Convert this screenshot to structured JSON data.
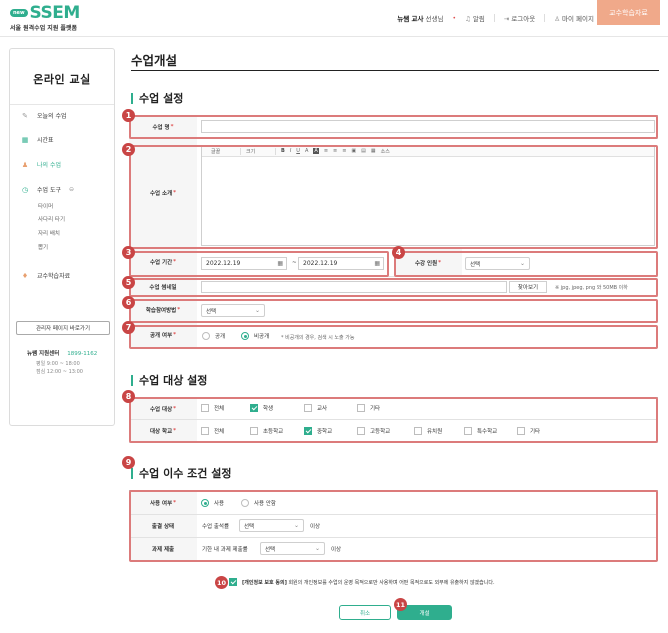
{
  "header": {
    "logo_new": "new",
    "logo_name": "SSEM",
    "logo_subtitle": "서울 원격수업 지원 플랫폼",
    "user_role": "뉴쌤 교사",
    "user_suffix": "선생님",
    "alarm": "알림",
    "logout": "로그아웃",
    "mypage": "마이 페이지",
    "prof_button": "교수학습자료"
  },
  "sidebar": {
    "title": "온라인 교실",
    "items": [
      {
        "label": "오늘의 수업",
        "icon": "pencil-icon"
      },
      {
        "label": "시간표",
        "icon": "calendar-icon"
      },
      {
        "label": "나의 수업",
        "icon": "person-icon"
      },
      {
        "label": "수업 도구",
        "icon": "stopwatch-icon"
      },
      {
        "label": "교수학습자료",
        "icon": "lightbulb-icon"
      }
    ],
    "tool_subitems": [
      "타이머",
      "사다리 타기",
      "자리 배치",
      "뽑기"
    ],
    "admin_button": "관리자 페이지 바로가기",
    "support_label": "뉴쌤 지원센터",
    "support_phone": "1899-1162",
    "hours_weekday": "평일 9:00 ~ 18:00",
    "hours_lunch": "점심 12:00 ~ 13:00"
  },
  "main": {
    "page_title": "수업개설",
    "section1_title": "수업 설정",
    "section2_title": "수업 대상 설정",
    "section3_title": "수업 이수 조건 설정",
    "fields": {
      "class_name_label": "수업 명",
      "class_intro_label": "수업 소개",
      "period_label": "수업 기간",
      "start_date": "2022.12.19",
      "date_sep": "~",
      "end_date": "2022.12.19",
      "capacity_label": "수강 인원",
      "capacity_value": "선택",
      "thumbnail_label": "수업 썸네일",
      "browse_button": "찾아보기",
      "thumbnail_hint": "※ jpg, jpeg, png 와 50MB 이하",
      "method_label": "학습참여방법",
      "method_value": "선택",
      "public_label": "공개 여부",
      "public_on": "공개",
      "public_off": "비공개",
      "public_hint": "* 비공개의 경우, 검색 시 노출 가능"
    },
    "editor_toolbar": [
      "글꼴",
      "크기",
      "B",
      "I",
      "U",
      "A",
      "A",
      "≡",
      "≡",
      "≡",
      "▣",
      "▤",
      "▦",
      "소스"
    ],
    "target": {
      "target_label": "수업 대상",
      "targets": [
        {
          "label": "전체",
          "checked": false
        },
        {
          "label": "학생",
          "checked": true
        },
        {
          "label": "교사",
          "checked": false
        },
        {
          "label": "기타",
          "checked": false
        }
      ],
      "school_label": "대상 학교",
      "schools": [
        {
          "label": "전체",
          "checked": false
        },
        {
          "label": "초등학교",
          "checked": false
        },
        {
          "label": "중학교",
          "checked": true
        },
        {
          "label": "고등학교",
          "checked": false
        },
        {
          "label": "유치원",
          "checked": false
        },
        {
          "label": "특수학교",
          "checked": false
        },
        {
          "label": "기타",
          "checked": false
        }
      ]
    },
    "completion": {
      "use_label": "사용 여부",
      "use_on": "사용",
      "use_off": "사용 안함",
      "attendance_label": "출결 상태",
      "attendance_prefix": "수업 출석률",
      "attendance_value": "선택",
      "attendance_suffix": "이상",
      "assignment_label": "과제 제출",
      "assignment_prefix": "기한 내 과제 제출률",
      "assignment_value": "선택",
      "assignment_suffix": "이상"
    },
    "privacy_bold": "[개인정보 보호 동의]",
    "privacy_text": "회원의 개인정보를 수업의 운영 목적으로만 사용하며 어떤 목적으로도 외부에 유출하지 않겠습니다.",
    "cancel_button": "취소",
    "submit_button": "개설"
  },
  "badges": [
    "1",
    "2",
    "3",
    "4",
    "5",
    "6",
    "7",
    "8",
    "9",
    "10",
    "11"
  ],
  "colors": {
    "brand": "#2fae8e",
    "highlight": "#dc7b7b",
    "badge": "#c94545",
    "accent_button": "#f0a98a"
  }
}
